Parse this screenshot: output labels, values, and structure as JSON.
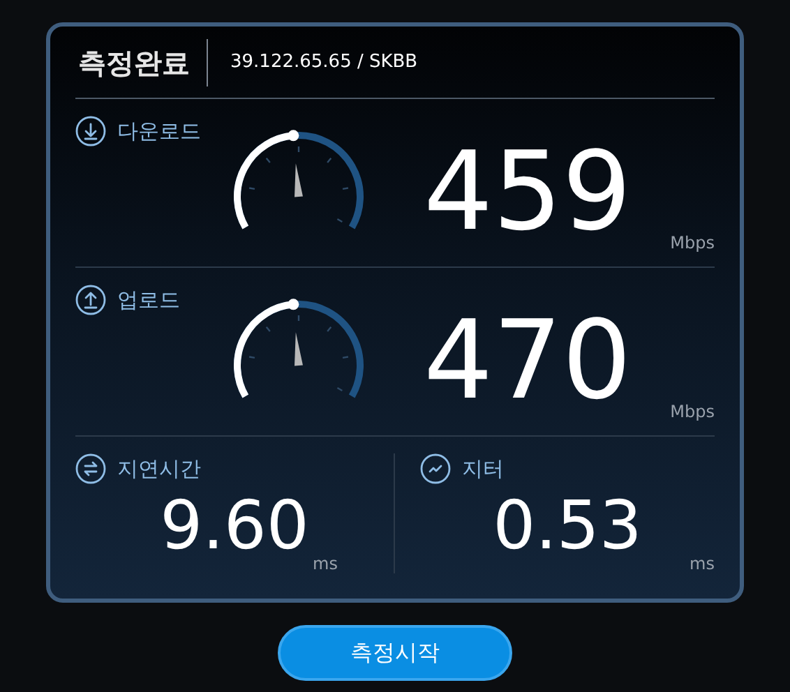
{
  "header": {
    "title": "측정완료",
    "server": "39.122.65.65 / SKBB"
  },
  "speeds": [
    {
      "kind": "download",
      "label": "다운로드",
      "value": "459",
      "unit": "Mbps"
    },
    {
      "kind": "upload",
      "label": "업로드",
      "value": "470",
      "unit": "Mbps"
    }
  ],
  "stats": [
    {
      "kind": "latency",
      "label": "지연시간",
      "value": "9.60",
      "unit": "ms"
    },
    {
      "kind": "jitter",
      "label": "지터",
      "value": "0.53",
      "unit": "ms"
    }
  ],
  "button": "측정시작"
}
